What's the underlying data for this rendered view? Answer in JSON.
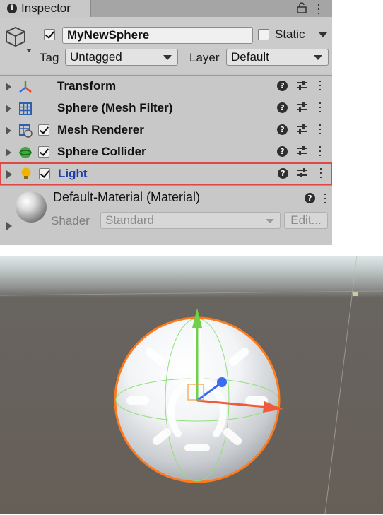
{
  "inspector": {
    "tab_title": "Inspector",
    "object_name": "MyNewSphere",
    "active": true,
    "static_label": "Static",
    "static": false,
    "tag_label": "Tag",
    "tag_value": "Untagged",
    "layer_label": "Layer",
    "layer_value": "Default"
  },
  "components": [
    {
      "name": "Transform",
      "icon": "transform-icon",
      "has_checkbox": false,
      "checked": false,
      "highlighted": false
    },
    {
      "name": "Sphere (Mesh Filter)",
      "icon": "mesh-filter-icon",
      "has_checkbox": false,
      "checked": false,
      "highlighted": false
    },
    {
      "name": "Mesh Renderer",
      "icon": "mesh-renderer-icon",
      "has_checkbox": true,
      "checked": true,
      "highlighted": false
    },
    {
      "name": "Sphere Collider",
      "icon": "sphere-collider-icon",
      "has_checkbox": true,
      "checked": true,
      "highlighted": false
    },
    {
      "name": "Light",
      "icon": "light-bulb-icon",
      "has_checkbox": true,
      "checked": true,
      "highlighted": true
    }
  ],
  "material": {
    "name": "Default-Material (Material)",
    "shader_label": "Shader",
    "shader_value": "Standard",
    "edit_label": "Edit..."
  },
  "colors": {
    "highlight_border": "#e04848",
    "selection_outline": "#ff7a1a",
    "gizmo_y": "#6fd04a",
    "gizmo_x": "#f05a3a",
    "gizmo_z": "#3b6cf0",
    "scene_ground": "#665f58"
  }
}
